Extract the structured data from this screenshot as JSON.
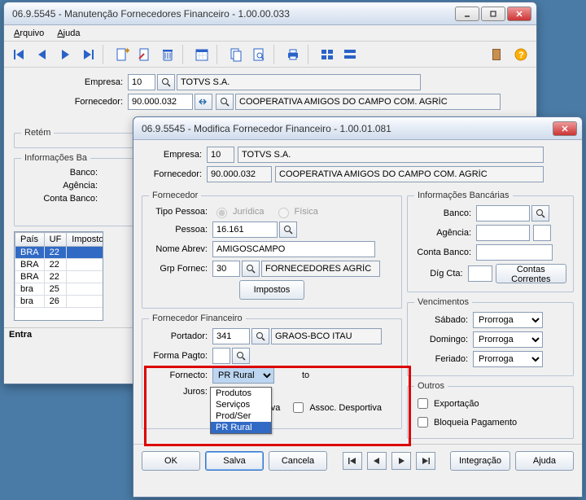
{
  "mainWindow": {
    "title": "06.9.5545 - Manutenção Fornecedores Financeiro - 1.00.00.033",
    "menu": {
      "arquivo": "Arquivo",
      "ajuda": "Ajuda"
    },
    "form": {
      "empresa_lbl": "Empresa:",
      "empresa_val": "10",
      "empresa_name": "TOTVS S.A.",
      "fornecedor_lbl": "Fornecedor:",
      "fornecedor_val": "90.000.032",
      "fornecedor_name": "COOPERATIVA AMIGOS DO CAMPO COM. AGRÍC"
    },
    "retem_lbl": "Retém",
    "info_banc_lbl": "Informações Ba",
    "banco_lbl": "Banco:",
    "agencia_lbl": "Agência:",
    "conta_lbl": "Conta Banco:",
    "grid": {
      "headers": [
        "País",
        "UF",
        "Imposto"
      ],
      "rows": [
        {
          "pais": "BRA",
          "uf": "22",
          "imp": ""
        },
        {
          "pais": "BRA",
          "uf": "22",
          "imp": ""
        },
        {
          "pais": "BRA",
          "uf": "22",
          "imp": ""
        },
        {
          "pais": "bra",
          "uf": "25",
          "imp": ""
        },
        {
          "pais": "bra",
          "uf": "26",
          "imp": ""
        }
      ]
    },
    "status": "Entra"
  },
  "modal": {
    "title": "06.9.5545 - Modifica Fornecedor Financeiro - 1.00.01.081",
    "empresa_lbl": "Empresa:",
    "empresa_val": "10",
    "empresa_name": "TOTVS S.A.",
    "fornecedor_lbl": "Fornecedor:",
    "fornecedor_val": "90.000.032",
    "fornecedor_name": "COOPERATIVA AMIGOS DO CAMPO COM. AGRÍC",
    "fs_fornecedor": "Fornecedor",
    "tipo_pessoa_lbl": "Tipo Pessoa:",
    "tp_juridica": "Jurídica",
    "tp_fisica": "Física",
    "pessoa_lbl": "Pessoa:",
    "pessoa_val": "16.161",
    "nome_abrev_lbl": "Nome Abrev:",
    "nome_abrev_val": "AMIGOSCAMPO",
    "grp_lbl": "Grp Fornec:",
    "grp_val": "30",
    "grp_name": "FORNECEDORES AGRÍC",
    "impostos_btn": "Impostos",
    "fs_fin": "Fornecedor Financeiro",
    "portador_lbl": "Portador:",
    "portador_val": "341",
    "portador_name": "GRAOS-BCO ITAU",
    "forma_pagto_lbl": "Forma Pagto:",
    "fornecto_lbl": "Fornecto:",
    "fornecto_val": "PR Rural",
    "fornecto_opts": [
      "Produtos",
      "Serviços",
      "Prod/Ser",
      "PR Rural"
    ],
    "fornecto_suffix": "to",
    "juros_lbl": "Juros:",
    "cooperativa_lbl": "Cooperativa",
    "assoc_lbl": "Assoc. Desportiva",
    "fs_info_banc": "Informações Bancárias",
    "banco_lbl": "Banco:",
    "agencia_lbl": "Agência:",
    "conta_lbl": "Conta Banco:",
    "dig_lbl": "Díg Cta:",
    "contas_btn": "Contas Correntes",
    "fs_venc": "Vencimentos",
    "sabado_lbl": "Sábado:",
    "sabado_val": "Prorroga",
    "domingo_lbl": "Domingo:",
    "domingo_val": "Prorroga",
    "feriado_lbl": "Feriado:",
    "feriado_val": "Prorroga",
    "fs_outros": "Outros",
    "exportacao_lbl": "Exportação",
    "bloqueia_lbl": "Bloqueia Pagamento",
    "btn_ok": "OK",
    "btn_salva": "Salva",
    "btn_cancela": "Cancela",
    "btn_integracao": "Integração",
    "btn_ajuda": "Ajuda"
  }
}
